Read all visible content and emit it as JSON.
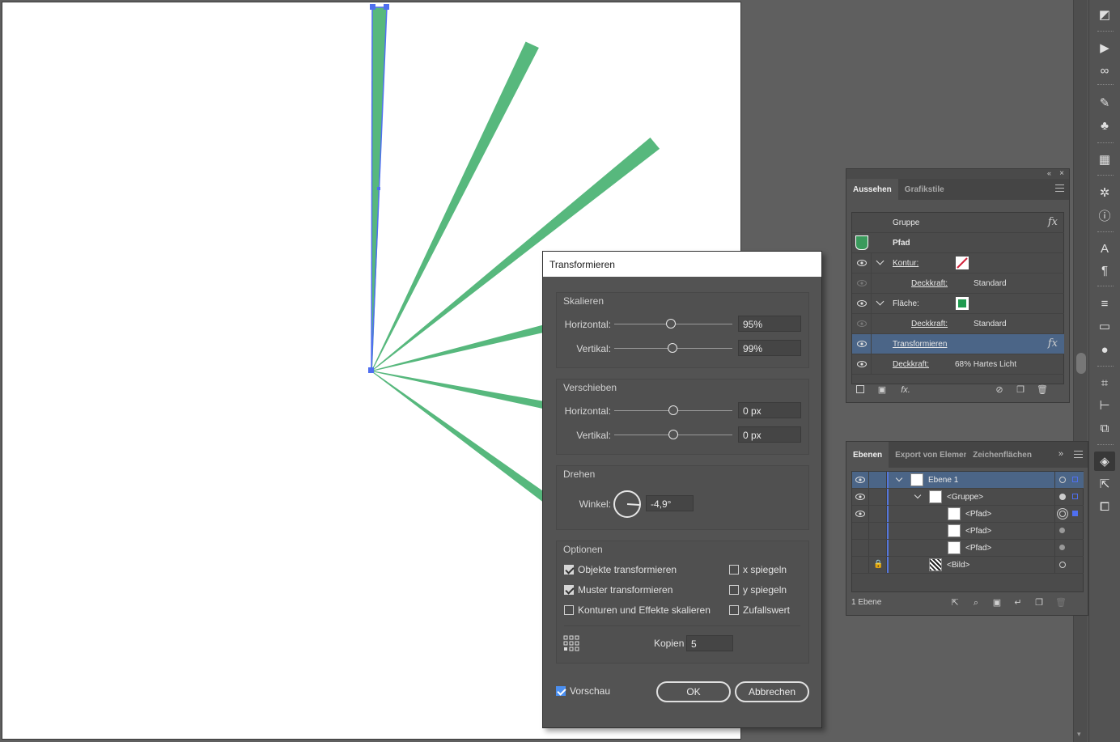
{
  "colors": {
    "shape_fill": "#57b87d",
    "selection": "#4f6ff0",
    "panel_bg": "#535353",
    "highlight_row": "#4b6587"
  },
  "dialog": {
    "title": "Transformieren",
    "scale": {
      "section": "Skalieren",
      "h_label": "Horizontal:",
      "h_value": "95%",
      "v_label": "Vertikal:",
      "v_value": "99%"
    },
    "move": {
      "section": "Verschieben",
      "h_label": "Horizontal:",
      "h_value": "0 px",
      "v_label": "Vertikal:",
      "v_value": "0 px"
    },
    "rotate": {
      "section": "Drehen",
      "angle_label": "Winkel:",
      "angle_value": "-4,9°"
    },
    "options": {
      "section": "Optionen",
      "transform_objects": {
        "label": "Objekte transformieren",
        "checked": true
      },
      "transform_patterns": {
        "label": "Muster transformieren",
        "checked": true
      },
      "scale_strokes": {
        "label": "Konturen und Effekte skalieren",
        "checked": false
      },
      "reflect_x": {
        "label": "x spiegeln",
        "checked": false
      },
      "reflect_y": {
        "label": "y spiegeln",
        "checked": false
      },
      "random": {
        "label": "Zufallswert",
        "checked": false
      }
    },
    "copies_label": "Kopien",
    "copies_value": "5",
    "preview_label": "Vorschau",
    "ok_label": "OK",
    "cancel_label": "Abbrechen"
  },
  "appearance": {
    "tabs": [
      "Aussehen",
      "Grafikstile"
    ],
    "rows": {
      "group": "Gruppe",
      "path": "Pfad",
      "stroke": "Kontur:",
      "stroke_opacity_label": "Deckkraft:",
      "stroke_opacity_value": "Standard",
      "fill": "Fläche:",
      "fill_opacity_label": "Deckkraft:",
      "fill_opacity_value": "Standard",
      "transform": "Transformieren",
      "opacity_label": "Deckkraft:",
      "opacity_value": "68% Hartes Licht"
    },
    "fx_label": "fx"
  },
  "layers": {
    "tabs": [
      "Ebenen",
      "Export von Elemen",
      "Zeichenflächen"
    ],
    "rows": [
      "Ebene 1",
      "<Gruppe>",
      "<Pfad>",
      "<Pfad>",
      "<Pfad>",
      "<Bild>"
    ],
    "footer": "1 Ebene"
  },
  "tools": [
    "color-guide-icon",
    "play-icon",
    "link-icon",
    "brush-icon",
    "symbol-icon",
    "swatch-grid-icon",
    "gear-icon",
    "info-icon",
    "character-icon",
    "paragraph-icon",
    "stroke-icon",
    "gradient-icon",
    "transparency-icon",
    "transform-icon",
    "align-icon",
    "pathfinder-icon",
    "layers-icon",
    "export-icon",
    "artboard-icon"
  ]
}
